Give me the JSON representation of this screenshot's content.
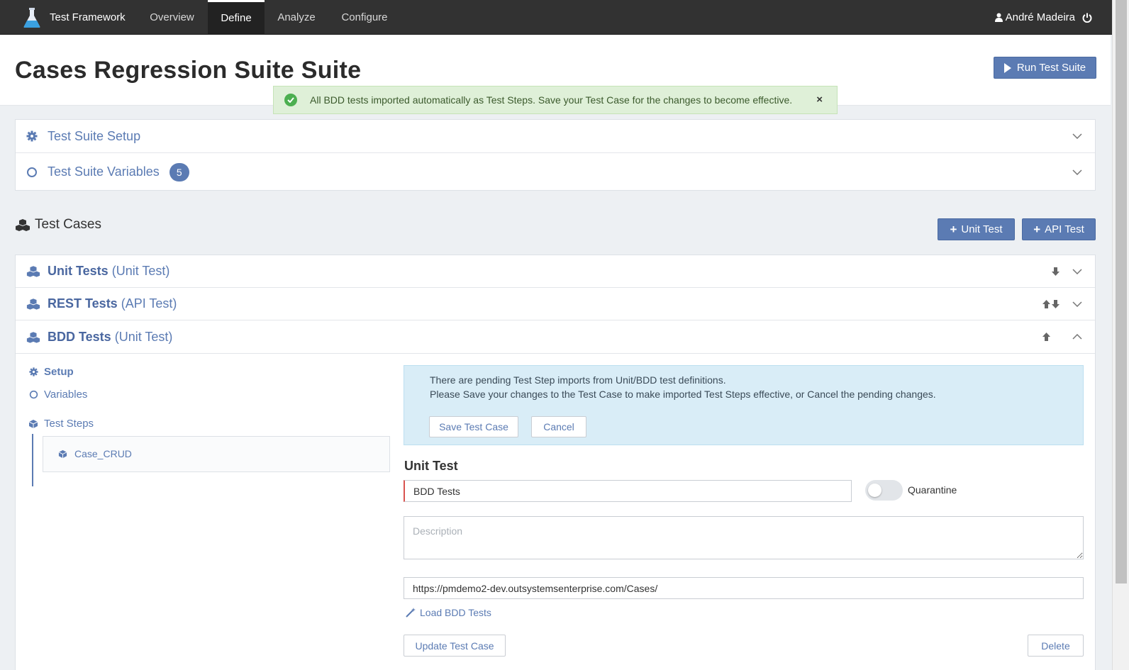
{
  "nav": {
    "brand": "Test Framework",
    "items": [
      {
        "label": "Overview"
      },
      {
        "label": "Define"
      },
      {
        "label": "Analyze"
      },
      {
        "label": "Configure"
      }
    ],
    "active": "Define",
    "user": "André Madeira"
  },
  "header": {
    "title": "Cases Regression Suite Suite",
    "run_button": "Run Test Suite"
  },
  "success_alert": {
    "message": "All BDD tests imported automatically as Test Steps. Save your Test Case for the changes to become effective.",
    "close": "×"
  },
  "suite_panels": [
    {
      "label": "Test Suite Setup",
      "icon": "gear-icon"
    },
    {
      "label": "Test Suite Variables",
      "icon": "circle-icon",
      "badge": "5"
    }
  ],
  "test_cases": {
    "title": "Test Cases",
    "add_unit": "Unit Test",
    "add_api": "API Test",
    "items": [
      {
        "name": "Unit Tests",
        "type": "(Unit Test)"
      },
      {
        "name": "REST Tests",
        "type": "(API Test)"
      },
      {
        "name": "BDD Tests",
        "type": "(Unit Test)"
      }
    ]
  },
  "expanded": {
    "nav": {
      "setup": "Setup",
      "variables": "Variables",
      "test_steps": "Test Steps",
      "steps": [
        "Case_CRUD"
      ]
    },
    "info_alert": {
      "line1": "There are pending Test Step imports from Unit/BDD test definitions.",
      "line2": "Please Save your changes to the Test Case to make imported Test Steps effective, or Cancel the pending changes.",
      "save": "Save Test Case",
      "cancel": "Cancel"
    },
    "form": {
      "title": "Unit Test",
      "name_value": "BDD Tests",
      "quarantine_label": "Quarantine",
      "quarantine_on": false,
      "description_placeholder": "Description",
      "url_value": "https://pmdemo2-dev.outsystemsenterprise.com/Cases/",
      "load_link": "Load BDD Tests",
      "update_button": "Update Test Case",
      "delete_button": "Delete"
    }
  },
  "colors": {
    "accent": "#5b7bb3",
    "nav_bg": "#323232",
    "success_bg": "#dff0d8",
    "info_bg": "#d9edf7"
  }
}
